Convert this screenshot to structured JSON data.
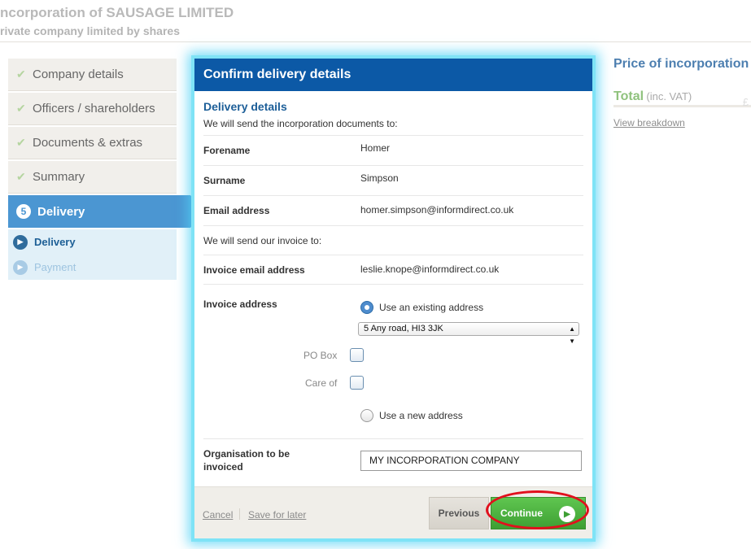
{
  "header": {
    "title": "ncorporation of SAUSAGE LIMITED",
    "subtitle": "rivate company limited by shares"
  },
  "sidebar": {
    "steps": [
      {
        "label": "Company details",
        "icon": "check-icon"
      },
      {
        "label": "Officers / shareholders",
        "icon": "check-icon"
      },
      {
        "label": "Documents & extras",
        "icon": "check-icon"
      },
      {
        "label": "Summary",
        "icon": "check-icon"
      }
    ],
    "active": {
      "number": "5",
      "label": "Delivery"
    },
    "substeps": [
      {
        "label": "Delivery",
        "icon": "arrow-circle-icon"
      },
      {
        "label": "Payment",
        "icon": "arrow-circle-icon"
      }
    ]
  },
  "price": {
    "title": "Price of incorporation",
    "total_label": "Total",
    "total_sub": "(inc. VAT)",
    "amount": "£",
    "breakdown_link": "View breakdown"
  },
  "modal": {
    "title": "Confirm delivery details",
    "section_title": "Delivery details",
    "send_note": "We will send the incorporation documents to:",
    "forename_label": "Forename",
    "forename": "Homer",
    "surname_label": "Surname",
    "surname": "Simpson",
    "email_label": "Email address",
    "email": "homer.simpson@informdirect.co.uk",
    "invoice_note": "We will send our invoice to:",
    "invoice_email_label": "Invoice email address",
    "invoice_email": "leslie.knope@informdirect.co.uk",
    "invoice_address_label": "Invoice address",
    "existing_option": "Use an existing address",
    "selected_address": "5 Any road, HI3 3JK",
    "po_box_label": "PO Box",
    "care_of_label": "Care of",
    "new_option": "Use a new address",
    "org_label": "Organisation to be invoiced",
    "org_value": "MY INCORPORATION COMPANY"
  },
  "footer": {
    "cancel": "Cancel",
    "save": "Save for later",
    "previous": "Previous",
    "continue": "Continue"
  },
  "colors": {
    "header_bar": "#0c59a6",
    "active_step": "#4b96d2",
    "continue": "#3e9f33",
    "highlight_ring": "#e1101d",
    "modal_glow": "#7fe3f6"
  }
}
